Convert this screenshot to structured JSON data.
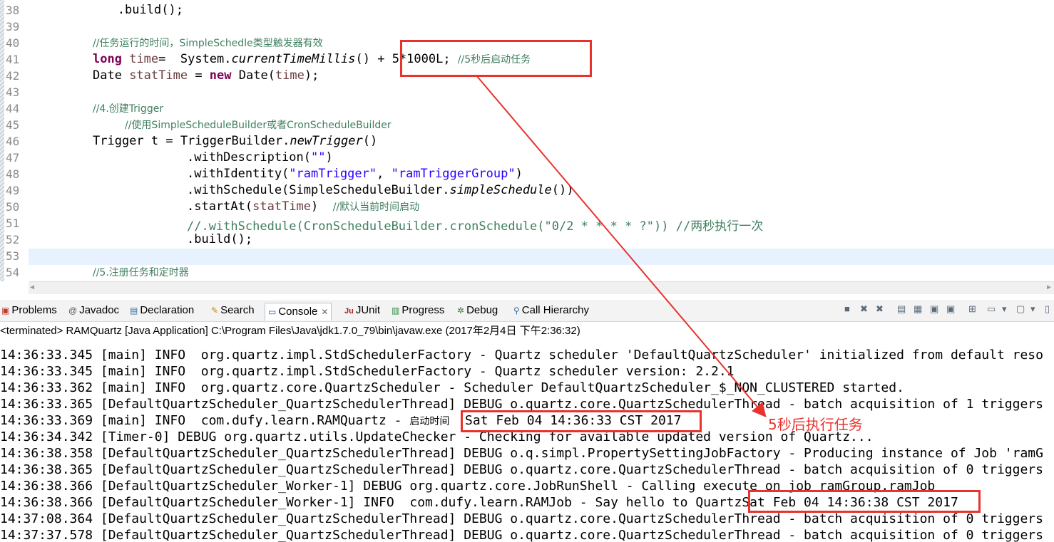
{
  "editor": {
    "lines": [
      {
        "num": "38",
        "text": "            .build();"
      },
      {
        "num": "39",
        "text": ""
      },
      {
        "num": "40",
        "comment": "//任务运行的时间，SimpleSchedle类型触发器有效"
      },
      {
        "num": "41",
        "kw": "long",
        "var": "time",
        "mid": "=  System.",
        "method": "currentTimeMillis",
        "tail": "() + 5*1000L; ",
        "comment": "//5秒后启动任务"
      },
      {
        "num": "42",
        "type": "Date ",
        "var": "statTime",
        "eq": " = ",
        "kw": "new",
        "tail": " Date(",
        "arg": "time",
        "end": ");"
      },
      {
        "num": "43",
        "text": ""
      },
      {
        "num": "44",
        "comment": "//4.创建Trigger"
      },
      {
        "num": "45",
        "comment": "//使用SimpleScheduleBuilder或者CronScheduleBuilder"
      },
      {
        "num": "46",
        "head": "Trigger t = TriggerBuilder.",
        "method": "newTrigger",
        "tail": "()"
      },
      {
        "num": "47",
        "head": ".withDescription(",
        "str": "\"\"",
        "tail": ")"
      },
      {
        "num": "48",
        "head": ".withIdentity(",
        "str1": "\"ramTrigger\"",
        "sep": ", ",
        "str2": "\"ramTriggerGroup\"",
        "tail": ")"
      },
      {
        "num": "49",
        "head": ".withSchedule(SimpleScheduleBuilder.",
        "method": "simpleSchedule",
        "tail": "())"
      },
      {
        "num": "50",
        "head": ".startAt(",
        "var": "statTime",
        "tail": ")  ",
        "comment": "//默认当前时间启动"
      },
      {
        "num": "51",
        "comment": "//.withSchedule(CronScheduleBuilder.cronSchedule(\"0/2 * * * * ?\")) //两秒执行一次"
      },
      {
        "num": "52",
        "text": ".build();"
      },
      {
        "num": "53",
        "text": ""
      },
      {
        "num": "54",
        "comment": "//5.注册任务和定时器"
      }
    ]
  },
  "tabs": {
    "problems": "Problems",
    "javadoc": "Javadoc",
    "declaration": "Declaration",
    "search": "Search",
    "console": "Console",
    "junit": "JUnit",
    "progress": "Progress",
    "debug": "Debug",
    "call_hierarchy": "Call Hierarchy"
  },
  "console": {
    "status": "<terminated> RAMQuartz [Java Application] C:\\Program Files\\Java\\jdk1.7.0_79\\bin\\javaw.exe (2017年2月4日 下午2:36:32)",
    "lines": [
      "14:36:33.345 [main] INFO  org.quartz.impl.StdSchedulerFactory - Quartz scheduler 'DefaultQuartzScheduler' initialized from default reso",
      "14:36:33.345 [main] INFO  org.quartz.impl.StdSchedulerFactory - Quartz scheduler version: 2.2.1",
      "14:36:33.362 [main] INFO  org.quartz.core.QuartzScheduler - Scheduler DefaultQuartzScheduler_$_NON_CLUSTERED started.",
      "14:36:33.365 [DefaultQuartzScheduler_QuartzSchedulerThread] DEBUG o.quartz.core.QuartzSchedulerThread - batch acquisition of 1 triggers",
      {
        "pre": "14:36:33.369 [main] INFO  com.dufy.learn.RAMQuartz - ",
        "cjk": "启动时间",
        "post": "  Sat Feb 04 14:36:33 CST 2017"
      },
      "14:36:34.342 [Timer-0] DEBUG org.quartz.utils.UpdateChecker - Checking for available updated version of Quartz...",
      "14:36:38.358 [DefaultQuartzScheduler_QuartzSchedulerThread] DEBUG o.q.simpl.PropertySettingJobFactory - Producing instance of Job 'ramG",
      "14:36:38.365 [DefaultQuartzScheduler_QuartzSchedulerThread] DEBUG o.quartz.core.QuartzSchedulerThread - batch acquisition of 0 triggers",
      "14:36:38.366 [DefaultQuartzScheduler_Worker-1] DEBUG org.quartz.core.JobRunShell - Calling execute on job ramGroup.ramJob",
      "14:36:38.366 [DefaultQuartzScheduler_Worker-1] INFO  com.dufy.learn.RAMJob - Say hello to QuartzSat Feb 04 14:36:38 CST 2017",
      "14:37:08.364 [DefaultQuartzScheduler_QuartzSchedulerThread] DEBUG o.quartz.core.QuartzSchedulerThread - batch acquisition of 0 triggers",
      "14:37:37.578 [DefaultQuartzScheduler_QuartzSchedulerThread] DEBUG o.quartz.core.QuartzSchedulerThread - batch acquisition of 0 triggers"
    ]
  },
  "annotation": {
    "text": "5秒后执行任务",
    "color": "#e8322e"
  },
  "colors": {
    "keyword": "#7f0055",
    "variable": "#6a3e3e",
    "string": "#2a00ff",
    "comment": "#3f7f5f",
    "current_line": "#e8f2fe"
  },
  "icons": {
    "problems": "problems-icon",
    "javadoc": "at-icon",
    "declaration": "declaration-icon",
    "search": "search-icon",
    "console": "console-icon",
    "junit": "junit-icon",
    "progress": "progress-icon",
    "debug": "bug-icon",
    "call_hierarchy": "hierarchy-icon"
  }
}
